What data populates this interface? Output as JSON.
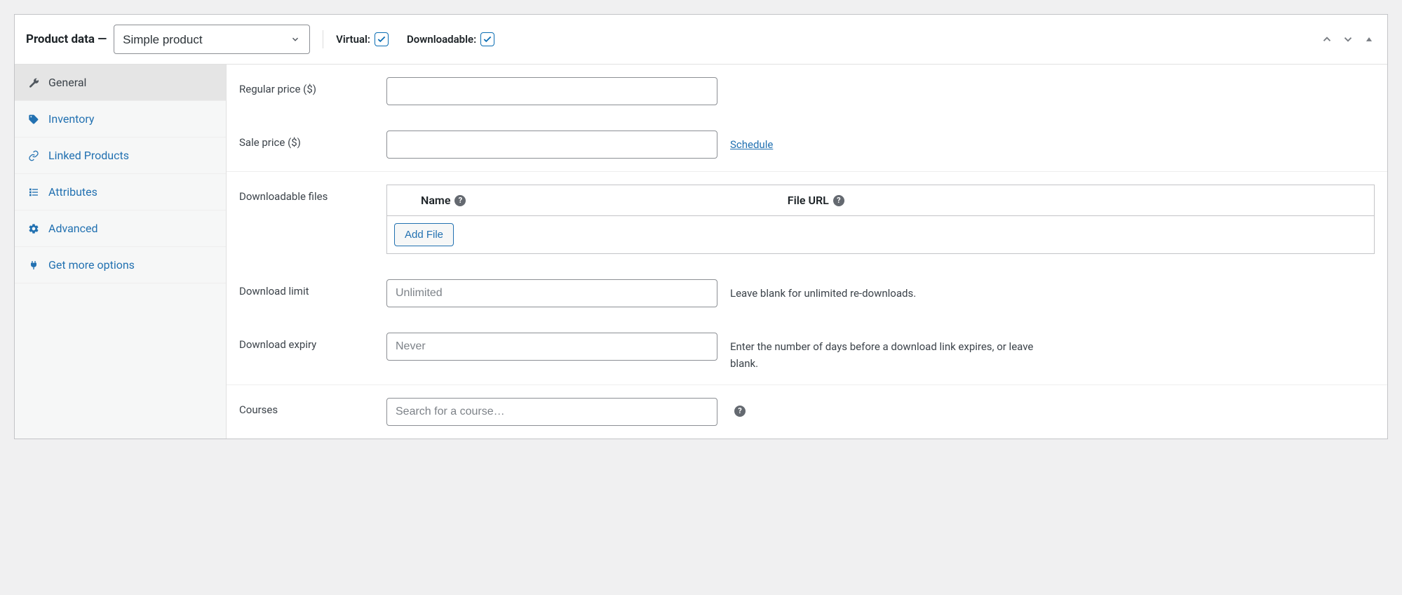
{
  "header": {
    "title": "Product data —",
    "product_type": "Simple product",
    "virtual_label": "Virtual:",
    "virtual_checked": true,
    "downloadable_label": "Downloadable:",
    "downloadable_checked": true
  },
  "tabs": [
    {
      "id": "general",
      "label": "General",
      "icon": "wrench",
      "active": true
    },
    {
      "id": "inventory",
      "label": "Inventory",
      "icon": "tag",
      "active": false
    },
    {
      "id": "linked",
      "label": "Linked Products",
      "icon": "link",
      "active": false
    },
    {
      "id": "attributes",
      "label": "Attributes",
      "icon": "list",
      "active": false
    },
    {
      "id": "advanced",
      "label": "Advanced",
      "icon": "gear",
      "active": false
    },
    {
      "id": "getmore",
      "label": "Get more options",
      "icon": "plug",
      "active": false
    }
  ],
  "fields": {
    "regular_price_label": "Regular price ($)",
    "regular_price_value": "",
    "sale_price_label": "Sale price ($)",
    "sale_price_value": "",
    "schedule_link": "Schedule",
    "downloadable_files_label": "Downloadable files",
    "dl_col_name": "Name",
    "dl_col_url": "File URL",
    "add_file_btn": "Add File",
    "download_limit_label": "Download limit",
    "download_limit_placeholder": "Unlimited",
    "download_limit_help": "Leave blank for unlimited re-downloads.",
    "download_expiry_label": "Download expiry",
    "download_expiry_placeholder": "Never",
    "download_expiry_help": "Enter the number of days before a download link expires, or leave blank.",
    "courses_label": "Courses",
    "courses_placeholder": "Search for a course…"
  }
}
